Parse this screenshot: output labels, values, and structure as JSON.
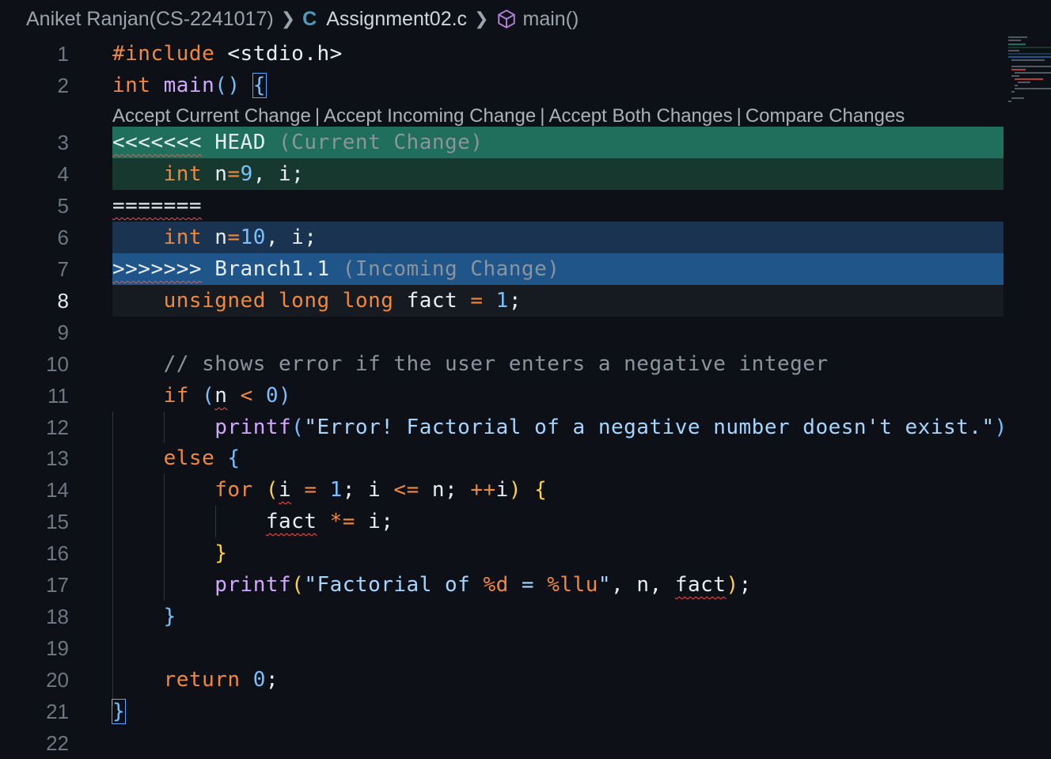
{
  "breadcrumb": {
    "folder": "Aniket Ranjan(CS-2241017)",
    "file": "Assignment02.c",
    "symbol": "main()",
    "file_icon": "C",
    "symbol_icon": "cube-icon"
  },
  "codelens": {
    "accept_current": "Accept Current Change",
    "accept_incoming": "Accept Incoming Change",
    "accept_both": "Accept Both Changes",
    "compare": "Compare Changes",
    "separator": "|"
  },
  "line_numbers": [
    "1",
    "2",
    "3",
    "4",
    "5",
    "6",
    "7",
    "8",
    "9",
    "10",
    "11",
    "12",
    "13",
    "14",
    "15",
    "16",
    "17",
    "18",
    "19",
    "20",
    "21",
    "22"
  ],
  "active_line": "8",
  "code": {
    "l1": {
      "directive": "#include",
      "header": " <stdio.h>"
    },
    "l2": {
      "type": "int",
      "space": " ",
      "name": "main",
      "parens": "()",
      "space2": " ",
      "brace": "{"
    },
    "l3": {
      "marker": "<<<<<<<",
      "label": " HEAD",
      "desc": " (Current Change)"
    },
    "l4": {
      "indent": "    ",
      "type": "int",
      "rest": " n",
      "eq": "=",
      "num": "9",
      "tail": ", i;"
    },
    "l5": {
      "marker": "======="
    },
    "l6": {
      "indent": "    ",
      "type": "int",
      "rest": " n",
      "eq": "=",
      "num": "10",
      "tail": ", i;"
    },
    "l7": {
      "marker": ">>>>>>>",
      "label": " Branch1.1",
      "desc": " (Incoming Change)"
    },
    "l8": {
      "indent": "    ",
      "t1": "unsigned",
      "t2": "long",
      "t3": "long",
      "var": "fact",
      "eq": "=",
      "num": "1",
      "semi": ";"
    },
    "l10": {
      "indent": "    ",
      "comment": "// shows error if the user enters a negative integer"
    },
    "l11": {
      "indent": "    ",
      "kw": "if",
      "open": "(",
      "var": "n",
      "op": "<",
      "num": "0",
      "close": ")"
    },
    "l12": {
      "indent": "        ",
      "fn": "printf",
      "open": "(",
      "str": "\"Error! Factorial of a negative number doesn't exist.\"",
      "close": ")"
    },
    "l13": {
      "indent": "    ",
      "kw": "else",
      "brace": "{"
    },
    "l14": {
      "indent": "        ",
      "kw": "for",
      "open": "(",
      "v1": "i",
      "eq": "=",
      "num": "1",
      "mid": "; i ",
      "op": "<=",
      "mid2": " n; ",
      "inc": "++",
      "v2": "i",
      "close": ")",
      "brace": "{"
    },
    "l15": {
      "indent": "            ",
      "var": "fact",
      "op": "*=",
      "tail": " i;"
    },
    "l16": {
      "indent": "        ",
      "brace": "}"
    },
    "l17": {
      "indent": "        ",
      "fn": "printf",
      "open": "(",
      "str1": "\"Factorial of ",
      "fmt1": "%d",
      "str2": " = ",
      "fmt2": "%llu",
      "str3": "\"",
      "mid": ", n, ",
      "var": "fact",
      "close": ")",
      "semi": ";"
    },
    "l18": {
      "indent": "    ",
      "brace": "}"
    },
    "l20": {
      "indent": "    ",
      "kw": "return",
      "num": "0",
      "semi": ";"
    },
    "l21": {
      "brace": "}"
    }
  },
  "colors": {
    "head_marker": "#1f6f5c",
    "current_change": "#16382f",
    "incoming_change": "#1a3350",
    "incoming_marker": "#1f5588",
    "error_squiggle": "#f85149"
  }
}
